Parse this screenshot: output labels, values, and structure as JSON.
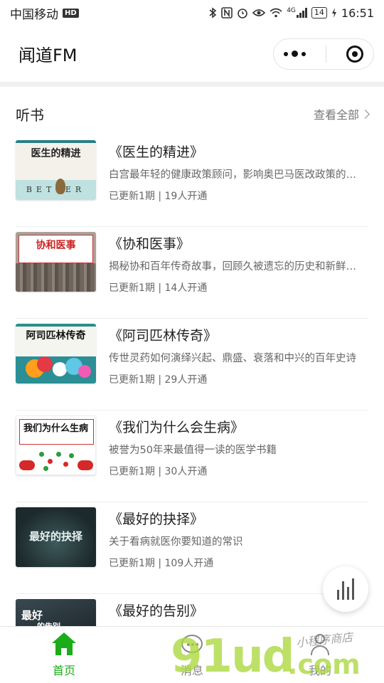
{
  "status_bar": {
    "carrier": "中国移动",
    "hd": "HD",
    "network": "4G",
    "battery": "14",
    "time": "16:51"
  },
  "nav": {
    "title": "闻道FM"
  },
  "section": {
    "title": "听书",
    "view_all": "查看全部"
  },
  "books": [
    {
      "title": "《医生的精进》",
      "desc": "白宫最年轻的健康政策顾问，影响奥巴马医改政策的…",
      "meta": "已更新1期 | 19人开通",
      "cover_title": "医生的精进",
      "cover_word": "BETTER"
    },
    {
      "title": "《协和医事》",
      "desc": "揭秘协和百年传奇故事，回顾久被遗忘的历史和新鲜…",
      "meta": "已更新1期 | 14人开通",
      "cover_title": "协和医事"
    },
    {
      "title": "《阿司匹林传奇》",
      "desc": "传世灵药如何演绎兴起、鼎盛、衰落和中兴的百年史诗",
      "meta": "已更新1期 | 29人开通",
      "cover_title": "阿司匹林传奇"
    },
    {
      "title": "《我们为什么会生病》",
      "desc": "被誉为50年来最值得一读的医学书籍",
      "meta": "已更新1期 | 30人开通",
      "cover_title": "我们为什么生病"
    },
    {
      "title": "《最好的抉择》",
      "desc": "关于看病就医你要知道的常识",
      "meta": "已更新1期 | 109人开通",
      "cover_title": "最好的抉择"
    },
    {
      "title": "《最好的告别》",
      "desc": "",
      "meta": "",
      "cover_title": "最好",
      "cover_title2": "的告别"
    }
  ],
  "tabs": [
    {
      "label": "首页",
      "active": true,
      "icon": "home-icon"
    },
    {
      "label": "消息",
      "active": false,
      "icon": "message-icon"
    },
    {
      "label": "我的",
      "active": false,
      "icon": "profile-icon"
    }
  ],
  "watermark": {
    "main": "91ud",
    "suffix": ".com",
    "caption": "小程序商店"
  },
  "colors": {
    "accent_green": "#1aad19",
    "text_secondary": "#666666"
  }
}
